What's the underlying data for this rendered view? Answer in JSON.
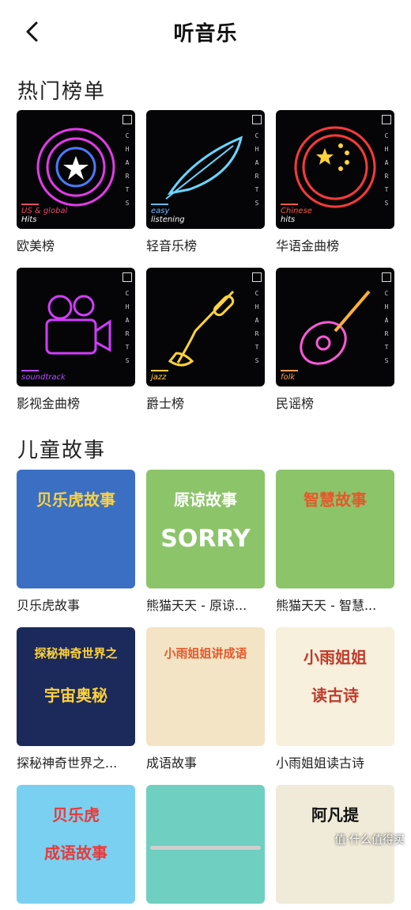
{
  "header": {
    "title": "听音乐",
    "back_icon": "chevron-left-icon"
  },
  "sections": {
    "hot": {
      "title": "热门榜单",
      "charts_letters": [
        "C",
        "H",
        "A",
        "R",
        "T",
        "S"
      ],
      "items": [
        {
          "label": "欧美榜",
          "tag_line1": "US & global",
          "tag_line2": "Hits",
          "neon_color": "#e23be8",
          "tag_color": "#e84a6a"
        },
        {
          "label": "轻音乐榜",
          "tag_line1": "easy",
          "tag_line2": "listening",
          "neon_color": "#6ad6ff",
          "tag_color": "#6ab8ff"
        },
        {
          "label": "华语金曲榜",
          "tag_line1": "Chinese",
          "tag_line2": "hits",
          "neon_color": "#ff3a3a",
          "tag_color": "#ff5a3a"
        },
        {
          "label": "影视金曲榜",
          "tag_line1": "soundtrack",
          "tag_line2": "",
          "neon_color": "#d23cff",
          "tag_color": "#b24cff"
        },
        {
          "label": "爵士榜",
          "tag_line1": "jazz",
          "tag_line2": "",
          "neon_color": "#ffd23a",
          "tag_color": "#ffcc33"
        },
        {
          "label": "民谣榜",
          "tag_line1": "folk",
          "tag_line2": "",
          "neon_color": "#ff5ad8",
          "tag_color": "#ff9a5a"
        }
      ]
    },
    "kids": {
      "title": "儿童故事",
      "items": [
        {
          "label": "贝乐虎故事",
          "art_text": "贝乐虎故事",
          "bg": "#3a6fc4"
        },
        {
          "label": "熊猫天天 - 原谅...",
          "art_text": "原谅故事",
          "art_text2": "SORRY",
          "bg": "#8cc46a"
        },
        {
          "label": "熊猫天天 - 智慧...",
          "art_text": "智慧故事",
          "bg": "#8cc46a"
        },
        {
          "label": "探秘神奇世界之...",
          "art_text": "探秘神奇世界之",
          "art_text2": "宇宙奥秘",
          "bg": "#1b2a5a"
        },
        {
          "label": "成语故事",
          "art_text": "小雨姐姐讲成语",
          "bg": "#f2e4c4"
        },
        {
          "label": "小雨姐姐读古诗",
          "art_text": "小雨姐姐",
          "art_text2": "读古诗",
          "bg": "#f6f0dc"
        },
        {
          "label": "",
          "art_text": "贝乐虎",
          "art_text2": "成语故事",
          "bg": "#7ad0f0"
        },
        {
          "label": "",
          "art_text": "",
          "bg": "#6fcfc0"
        },
        {
          "label": "",
          "art_text": "阿凡提",
          "bg": "#f0ead8"
        }
      ]
    }
  },
  "watermark": "值·什么值得买"
}
